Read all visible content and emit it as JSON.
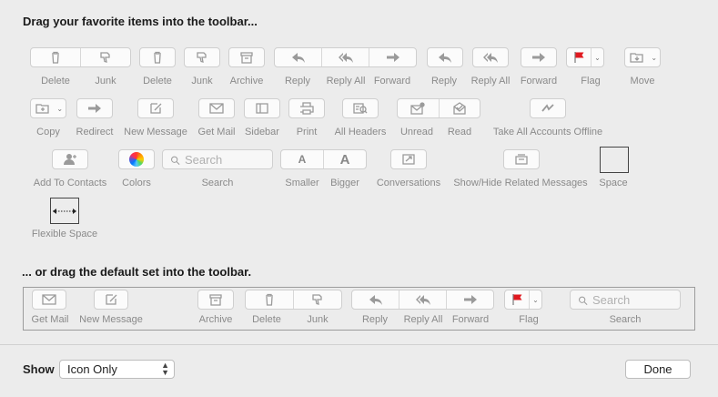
{
  "headings": {
    "favorites": "Drag your favorite items into the toolbar...",
    "defaults": "... or drag the default set into the toolbar."
  },
  "items": {
    "delete_junk_seg": {
      "delete": "Delete",
      "junk": "Junk"
    },
    "delete": "Delete",
    "junk": "Junk",
    "archive": "Archive",
    "reply_seg": {
      "reply": "Reply",
      "reply_all": "Reply All",
      "forward": "Forward"
    },
    "reply": "Reply",
    "reply_all": "Reply All",
    "forward": "Forward",
    "flag": "Flag",
    "move": "Move",
    "copy": "Copy",
    "redirect": "Redirect",
    "new_message": "New Message",
    "get_mail": "Get Mail",
    "sidebar": "Sidebar",
    "print": "Print",
    "all_headers": "All Headers",
    "unread": "Unread",
    "read": "Read",
    "take_offline": "Take All Accounts Offline",
    "add_to_contacts": "Add To Contacts",
    "colors": "Colors",
    "search": "Search",
    "search_placeholder": "Search",
    "smaller": "Smaller",
    "bigger": "Bigger",
    "conversations": "Conversations",
    "show_hide_related": "Show/Hide Related Messages",
    "space": "Space",
    "flexible_space": "Flexible Space",
    "font_glyph": "A"
  },
  "default_set": {
    "get_mail": "Get Mail",
    "new_message": "New Message",
    "archive": "Archive",
    "delete": "Delete",
    "junk": "Junk",
    "reply": "Reply",
    "reply_all": "Reply All",
    "forward": "Forward",
    "flag": "Flag",
    "search": "Search",
    "search_placeholder": "Search"
  },
  "footer": {
    "show_label": "Show",
    "show_value": "Icon Only",
    "done_label": "Done"
  },
  "colors": {
    "flag_red": "#e0191f",
    "accent_border": "#9c9c9c"
  }
}
